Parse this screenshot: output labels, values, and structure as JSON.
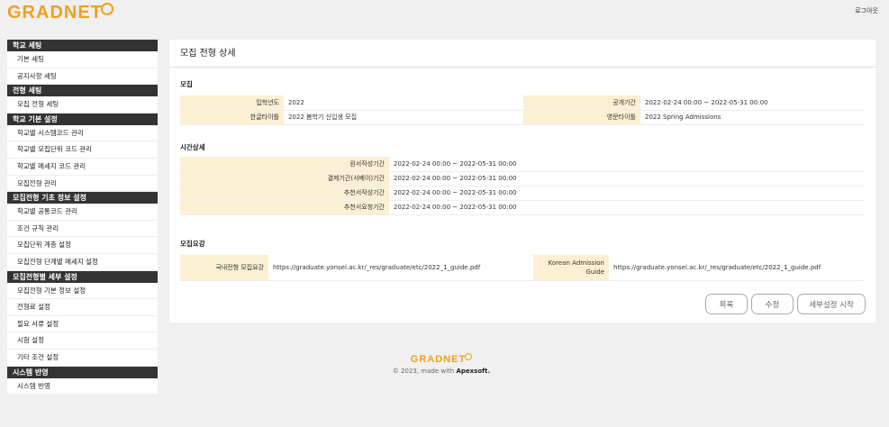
{
  "header": {
    "logo_text": "GRADNET",
    "logout_label": "로그아웃"
  },
  "sidebar": {
    "groups": [
      {
        "title": "학교 세팅",
        "items": [
          "기본 세팅",
          "공지사항 세팅"
        ]
      },
      {
        "title": "전형 세팅",
        "items": [
          "모집 전형 세팅"
        ]
      },
      {
        "title": "학교 기본 설정",
        "items": [
          "학교별 시스템코드 관리",
          "학교별 모집단위 코드 관리",
          "학교별 메세지 코드 관리",
          "모집전형 관리"
        ]
      },
      {
        "title": "모집전형 기초 정보 설정",
        "items": [
          "학교별 공통코드 관리",
          "조건 규칙 관리",
          "모집단위 계층 설정",
          "모집전형 단계별 메세지 설정"
        ]
      },
      {
        "title": "모집전형별 세부 설정",
        "items": [
          "모집전형 기본 정보 설정",
          "전형료 설정",
          "필요 서류 설정",
          "시험 설정",
          "기타 조건 설정"
        ]
      },
      {
        "title": "시스템 반영",
        "items": [
          "시스템 반영"
        ]
      }
    ]
  },
  "main": {
    "title": "모집 전형 상세",
    "recruit": {
      "section": "모집",
      "year_label": "입학년도",
      "year_value": "2022",
      "public_label": "공개기간",
      "public_value": "2022-02-24 00:00 ~ 2022-05-31 00:00",
      "kor_title_label": "한글타이틀",
      "kor_title_value": "2022 봄학기 신입생 모집",
      "eng_title_label": "영문타이틀",
      "eng_title_value": "2022 Spring Admissions"
    },
    "time": {
      "section": "시간상세",
      "rows": [
        {
          "label": "원서작성기간",
          "value": "2022-02-24 00:00 ~ 2022-05-31 00:00"
        },
        {
          "label": "결제기간(서베이)기간",
          "value": "2022-02-24 00:00 ~ 2022-05-31 00:00"
        },
        {
          "label": "추천서작성기간",
          "value": "2022-02-24 00:00 ~ 2022-05-31 00:00"
        },
        {
          "label": "추천서요청기간",
          "value": "2022-02-24 00:00 ~ 2022-05-31 00:00"
        }
      ]
    },
    "guide": {
      "section": "모집요강",
      "kor_label": "국내전형 모집요강",
      "kor_value": "https://graduate.yonsei.ac.kr/_res/graduate/etc/2022_1_guide.pdf",
      "eng_label": "Korean Admission Guide",
      "eng_value": "https://graduate.yonsei.ac.kr/_res/graduate/etc/2022_1_guide.pdf"
    },
    "buttons": {
      "list": "목록",
      "edit": "수정",
      "detail": "세부설정 시작"
    }
  },
  "footer": {
    "logo_text": "GRADNET",
    "copy_prefix": "© 2023, made with ",
    "copy_brand": "Apexsoft."
  },
  "colors": {
    "brand": "#f0a020",
    "label_bg": "#fbf0d4",
    "sidebar_header": "#333333"
  }
}
